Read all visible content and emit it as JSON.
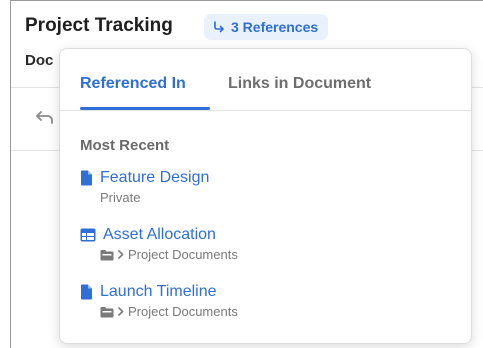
{
  "page": {
    "title": "Project Tracking",
    "references_badge": "3 References",
    "doc_label_partial": "Doc"
  },
  "popover": {
    "tabs": [
      {
        "label": "Referenced In",
        "active": true
      },
      {
        "label": "Links in Document",
        "active": false
      }
    ],
    "section_heading": "Most Recent",
    "items": [
      {
        "icon": "document-icon",
        "title": "Feature Design",
        "subtitle": "Private",
        "has_folder": false
      },
      {
        "icon": "table-icon",
        "title": "Asset Allocation",
        "subtitle": "Project Documents",
        "has_folder": true
      },
      {
        "icon": "document-icon",
        "title": "Launch Timeline",
        "subtitle": "Project Documents",
        "has_folder": true
      }
    ]
  },
  "colors": {
    "accent": "#2f6fd6",
    "badge_bg": "#e9f1fc",
    "muted_text": "#7a7a7a"
  }
}
